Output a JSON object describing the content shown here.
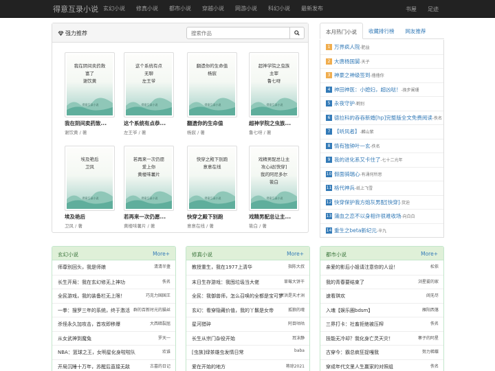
{
  "nav": {
    "brand": "得意互录小说",
    "links": [
      "玄幻小说",
      "修真小说",
      "都市小说",
      "穿越小说",
      "网游小说",
      "科幻小说",
      "最新发布"
    ],
    "right": [
      "书屋",
      "足迹"
    ]
  },
  "featured": {
    "title": "强力推荐",
    "search_placeholder": "搜索作品",
    "watermark": "得意互录小说",
    "books": [
      {
        "cover": "我在阴间卖药救\n富了\n谢饮黄",
        "title": "我在阴间卖药致...",
        "author": "谢饮黄 / 著"
      },
      {
        "cover": "这个系统有点\n无聊\n左王爷",
        "title": "这个系统有点恭...",
        "author": "左王爷 / 著"
      },
      {
        "cover": "翻遗你的生命值\n杨宸",
        "title": "翻遗你的生命值",
        "author": "杨宸 / 著"
      },
      {
        "cover": "超神学院之虫族\n主宰\n鲁七呀",
        "title": "超神学院之虫族...",
        "author": "鲁七呀 / 著"
      },
      {
        "cover": "埃及艳后\n卫风",
        "title": "埃及艳后",
        "author": "卫风 / 著"
      },
      {
        "cover": "若再来一次仍愿\n爱上你\n黄楼味薯片",
        "title": "若再来一次仍愿...",
        "author": "黄楼味薯片 / 著"
      },
      {
        "cover": "快穿之殿下别跑\n意意在线",
        "title": "快穿之殿下别跑",
        "author": "意意在线 / 著"
      },
      {
        "cover": "戏精男配总让主\n攻心动[快穿]\n我的阿尼多尔\n筱白",
        "title": "戏精男配总让主...",
        "author": "筱白 / 著"
      }
    ]
  },
  "hot": {
    "tabs": [
      "本月热门小说",
      "收藏排行榜",
      "网友推荐"
    ],
    "items": [
      {
        "rank": "1",
        "title": "万界疯人院",
        "author": "-肥益"
      },
      {
        "rank": "2",
        "title": "大唐杨国舅",
        "author": "-天子"
      },
      {
        "rank": "3",
        "title": "神豪之神级签到",
        "author": "-撸撸你"
      },
      {
        "rank": "4",
        "title": "神田神医：小媳妇，超凶哒！",
        "author": "-挽步阑珊"
      },
      {
        "rank": "5",
        "title": "永夜守护",
        "author": "-鹤别"
      },
      {
        "rank": "6",
        "title": "德拉科的吞吞新婚[hp]完整版全文免费阅读",
        "author": "-佚名"
      },
      {
        "rank": "7",
        "title": "【听风者】",
        "author": "-麟山紫"
      },
      {
        "rank": "8",
        "title": "情有独钟叶一玄",
        "author": "-佚名"
      },
      {
        "rank": "9",
        "title": "我的进化系又卡住了",
        "author": "-七十二光年"
      },
      {
        "rank": "10",
        "title": "假面骑瑞心",
        "author": "-有涌何所思"
      },
      {
        "rank": "11",
        "title": "格代神兵",
        "author": "-纸上飞雪"
      },
      {
        "rank": "12",
        "title": "快穿保护我方炮灰男配[快穿]",
        "author": "-货迫"
      },
      {
        "rank": "13",
        "title": "蒲血之恋不以身相许很难收场",
        "author": "-向白白"
      },
      {
        "rank": "14",
        "title": "重生之beta新纪元",
        "author": "-辛九"
      }
    ]
  },
  "categories": [
    {
      "title": "玄幻小说",
      "more": "More+",
      "rows": [
        {
          "title": "师尊别回头，我是师娘",
          "author": "清清半盏"
        },
        {
          "title": "长生开局：我在玄幻修无上神功",
          "author": "佚名"
        },
        {
          "title": "全民游戏，我的装备栏无上限！",
          "author": "巧克力国国王"
        },
        {
          "title": "一拳：搜罗三年的系统，终于激活",
          "author": "群的百新时光的猫丝"
        },
        {
          "title": "杀怪永久加攻击，首攻即移爆",
          "author": "大西暗裂屈"
        },
        {
          "title": "从女武神到魔兔",
          "author": "罗天一"
        },
        {
          "title": "NBA：篮球之王，女明星化身啦啦队",
          "author": "欢谁"
        },
        {
          "title": "开局沉睡十万年，苏醒后直接无敌",
          "author": "古墓的日记"
        }
      ]
    },
    {
      "title": "修真小说",
      "more": "More+",
      "rows": [
        {
          "title": "教授重生，我在1977上清华",
          "author": "指陈大叔"
        },
        {
          "title": "末日生存游戏：我囤垃圾当大佬",
          "author": "草莓大饼干"
        },
        {
          "title": "全民：我御兽师，怎么召唤的全都是宝可梦",
          "author": "宗洪是天才洲"
        },
        {
          "title": "玄幻：看穿隐藏价值，我的丫鬟是女帝",
          "author": "孤狼的魂"
        },
        {
          "title": "星河猎碎",
          "author": "阿目咕咕"
        },
        {
          "title": "长生从宗门杂役开始",
          "author": "耳沫静"
        },
        {
          "title": "[虫族]绿茶雄虫发情日常",
          "author": "baba"
        },
        {
          "title": "爱在开始的地方",
          "author": "蒋琼2021"
        }
      ]
    },
    {
      "title": "都市小说",
      "more": "More+",
      "rows": [
        {
          "title": "亲爱的影后小姐请注意你的人设！",
          "author": "松依"
        },
        {
          "title": "我的青春要结束了",
          "author": "浏星雾的家"
        },
        {
          "title": "速看琪欢",
          "author": "阔无尽"
        },
        {
          "title": "入魂【娱乐圈bdsm】",
          "author": "雁阳西落"
        },
        {
          "title": "三界打卡：社畜拒绝被压榨",
          "author": "佚名"
        },
        {
          "title": "技能无冷却？我化身亡灵天灾！",
          "author": "寨子的阿星"
        },
        {
          "title": "古穿今：霸总疯狂捉嘎我",
          "author": "努力稀蝶"
        },
        {
          "title": "穿成年代文里人生赢家的对照组",
          "author": "佚名"
        }
      ]
    }
  ]
}
